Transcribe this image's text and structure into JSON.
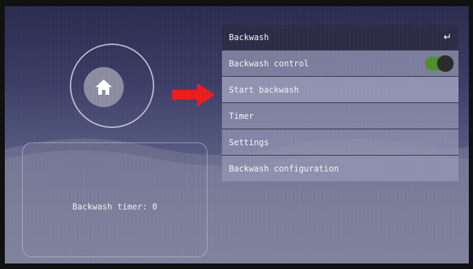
{
  "menu": {
    "title": "Backwash",
    "back_icon": "return-arrow-icon",
    "items": [
      {
        "label": "Backwash control",
        "toggle": true
      },
      {
        "label": "Start backwash"
      },
      {
        "label": "Timer"
      },
      {
        "label": "Settings"
      },
      {
        "label": "Backwash configuration"
      }
    ]
  },
  "home": {
    "icon": "home-icon"
  },
  "timer": {
    "label": "Backwash timer: 0"
  },
  "annotation": {
    "icon": "red-arrow-icon",
    "color": "#ee1b1b"
  },
  "colors": {
    "toggle_on": "#4f8e2f",
    "header_bg": "#2c2c46",
    "menu_item_bg": "#9698b4"
  }
}
